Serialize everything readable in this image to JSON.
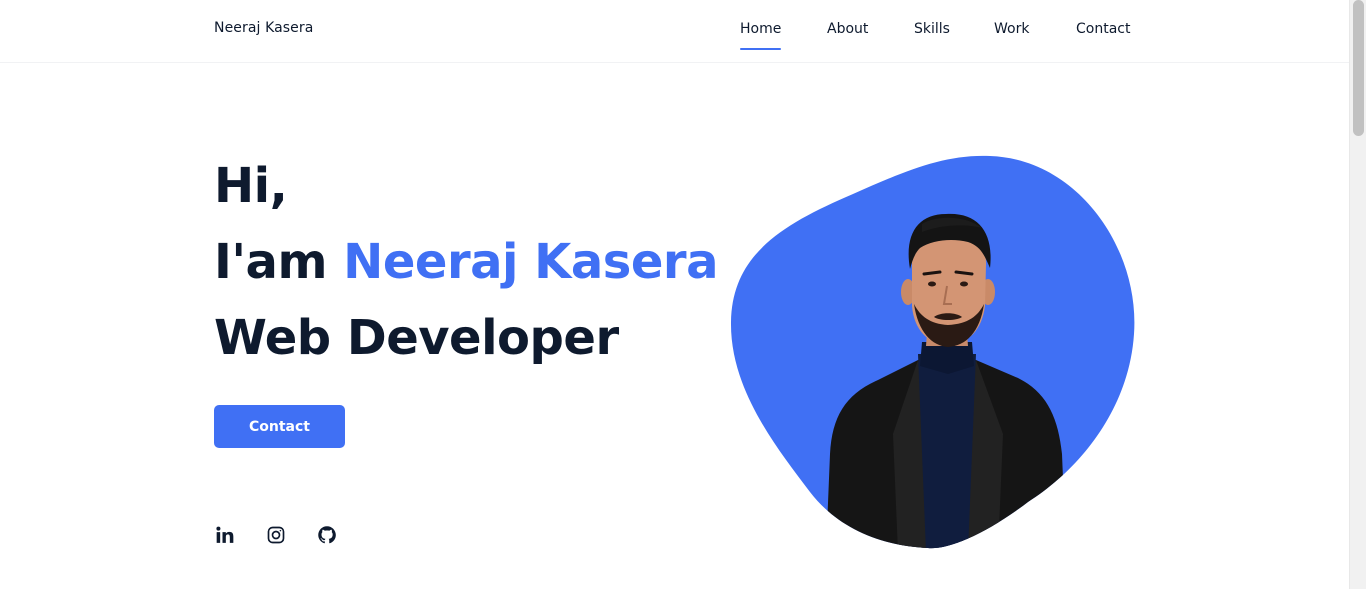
{
  "header": {
    "brand": "Neeraj Kasera",
    "nav": [
      {
        "label": "Home",
        "active": true
      },
      {
        "label": "About",
        "active": false
      },
      {
        "label": "Skills",
        "active": false
      },
      {
        "label": "Work",
        "active": false
      },
      {
        "label": "Contact",
        "active": false
      }
    ]
  },
  "hero": {
    "greeting": "Hi,",
    "intro_prefix": "I'am ",
    "name": "Neeraj Kasera",
    "role": "Web Developer",
    "cta_label": "Contact"
  },
  "socials": [
    {
      "icon": "linkedin-icon"
    },
    {
      "icon": "instagram-icon"
    },
    {
      "icon": "github-icon"
    }
  ],
  "colors": {
    "accent": "#4070f4",
    "text": "#0e1a2e",
    "background": "#ffffff"
  }
}
